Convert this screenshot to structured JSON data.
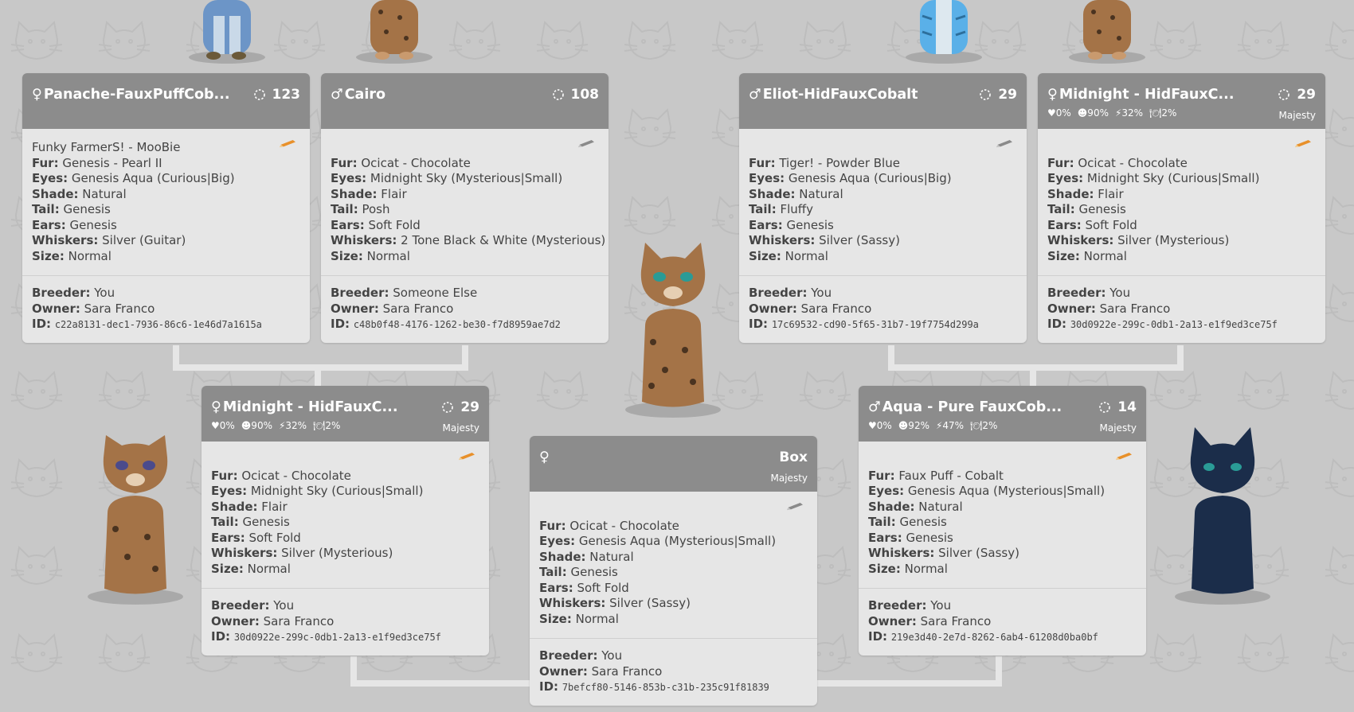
{
  "colors": {
    "background": "#c8c8c8",
    "card": "#e6e6e6",
    "header": "#8c8c8c",
    "pencil_active": "#e8902a",
    "pencil_inactive": "#8a8a8a"
  },
  "labels": {
    "fur": "Fur:",
    "eyes": "Eyes:",
    "shade": "Shade:",
    "tail": "Tail:",
    "ears": "Ears:",
    "whiskers": "Whiskers:",
    "size": "Size:",
    "breeder": "Breeder:",
    "owner": "Owner:",
    "id": "ID:"
  },
  "cards": {
    "ggp1": {
      "gender": "♀",
      "name": "Panache-FauxPuffCob...",
      "gen": "123",
      "subtitle": "Funky FarmerS! - MooBie",
      "fur": "Genesis - Pearl II",
      "eyes": "Genesis Aqua (Curious|Big)",
      "shade": "Natural",
      "tail": "Genesis",
      "ears": "Genesis",
      "whiskers": "Silver (Guitar)",
      "size": "Normal",
      "breeder": "You",
      "owner": "Sara Franco",
      "id": "c22a8131-dec1-7936-86c6-1e46d7a1615a",
      "pencil": "pencil-active-icon"
    },
    "ggp2": {
      "gender": "♂",
      "name": "Cairo",
      "gen": "108",
      "fur": "Ocicat - Chocolate",
      "eyes": "Midnight Sky (Mysterious|Small)",
      "shade": "Flair",
      "tail": "Posh",
      "ears": "Soft Fold",
      "whiskers": "2 Tone Black & White (Mysterious)",
      "size": "Normal",
      "breeder": "Someone Else",
      "owner": "Sara Franco",
      "id": "c48b0f48-4176-1262-be30-f7d8959ae7d2",
      "pencil": "pencil-inactive-icon"
    },
    "ggp3": {
      "gender": "♂",
      "name": "Eliot-HidFauxCobalt",
      "gen": "29",
      "fur": "Tiger! - Powder Blue",
      "eyes": "Genesis Aqua (Curious|Big)",
      "shade": "Natural",
      "tail": "Fluffy",
      "ears": "Genesis",
      "whiskers": "Silver (Sassy)",
      "size": "Normal",
      "breeder": "You",
      "owner": "Sara Franco",
      "id": "17c69532-cd90-5f65-31b7-19f7754d299a",
      "pencil": "pencil-inactive-icon"
    },
    "ggp4": {
      "gender": "♀",
      "name": "Midnight - HidFauxC...",
      "gen": "29",
      "stats": {
        "love": "♥0%",
        "happy": "☻90%",
        "energy": "⚡32%",
        "hunger": "🍽2%"
      },
      "title": "Majesty",
      "fur": "Ocicat - Chocolate",
      "eyes": "Midnight Sky (Curious|Small)",
      "shade": "Flair",
      "tail": "Genesis",
      "ears": "Soft Fold",
      "whiskers": "Silver (Mysterious)",
      "size": "Normal",
      "breeder": "You",
      "owner": "Sara Franco",
      "id": "30d0922e-299c-0db1-2a13-e1f9ed3ce75f",
      "pencil": "pencil-active-icon"
    },
    "gp1": {
      "gender": "♀",
      "name": "Midnight - HidFauxC...",
      "gen": "29",
      "stats": {
        "love": "♥0%",
        "happy": "☻90%",
        "energy": "⚡32%",
        "hunger": "🍽2%"
      },
      "title": "Majesty",
      "fur": "Ocicat - Chocolate",
      "eyes": "Midnight Sky (Curious|Small)",
      "shade": "Flair",
      "tail": "Genesis",
      "ears": "Soft Fold",
      "whiskers": "Silver (Mysterious)",
      "size": "Normal",
      "breeder": "You",
      "owner": "Sara Franco",
      "id": "30d0922e-299c-0db1-2a13-e1f9ed3ce75f",
      "pencil": "pencil-active-icon"
    },
    "self": {
      "gender": "♀",
      "name": "",
      "gen": "",
      "box": "Box",
      "title": "Majesty",
      "fur": "Ocicat - Chocolate",
      "eyes": "Genesis Aqua (Mysterious|Small)",
      "shade": "Natural",
      "tail": "Genesis",
      "ears": "Soft Fold",
      "whiskers": "Silver (Sassy)",
      "size": "Normal",
      "breeder": "You",
      "owner": "Sara Franco",
      "id": "7befcf80-5146-853b-c31b-235c91f81839",
      "pencil": "pencil-inactive-icon"
    },
    "gp2": {
      "gender": "♂",
      "name": "Aqua - Pure FauxCob...",
      "gen": "14",
      "stats": {
        "love": "♥0%",
        "happy": "☻92%",
        "energy": "⚡47%",
        "hunger": "🍽2%"
      },
      "title": "Majesty",
      "fur": "Faux Puff - Cobalt",
      "eyes": "Genesis Aqua (Mysterious|Small)",
      "shade": "Natural",
      "tail": "Genesis",
      "ears": "Genesis",
      "whiskers": "Silver (Sassy)",
      "size": "Normal",
      "breeder": "You",
      "owner": "Sara Franco",
      "id": "219e3d40-2e7d-8262-6ab4-61208d0ba0bf",
      "pencil": "pencil-active-icon"
    }
  }
}
